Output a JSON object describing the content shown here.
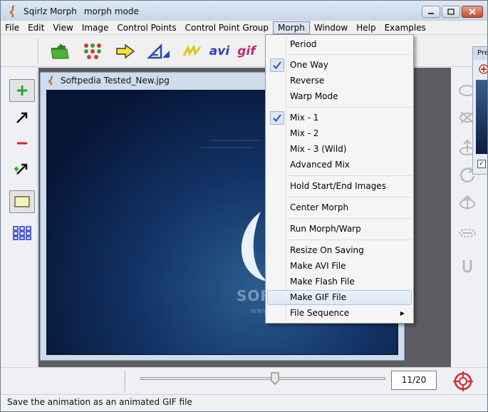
{
  "window": {
    "title": "Sqirlz Morph",
    "mode": "morph mode",
    "minimize_icon": "minimize-icon",
    "maximize_icon": "maximize-icon",
    "close_icon": "close-icon"
  },
  "menubar": {
    "items": [
      "File",
      "Edit",
      "View",
      "Image",
      "Control Points",
      "Control Point Group",
      "Morph",
      "Window",
      "Help",
      "Examples"
    ],
    "active": "Morph"
  },
  "toolbar": {
    "buttons": [
      {
        "icon": "open-folder-icon"
      },
      {
        "icon": "control-points-icon"
      },
      {
        "icon": "arrow-right-icon"
      },
      {
        "icon": "warp-triangle-icon"
      },
      {
        "icon": "flash-icon"
      },
      {
        "label": "avi",
        "icon": "avi-icon"
      },
      {
        "label": "gif",
        "icon": "gif-icon"
      }
    ],
    "avi_label": "avi",
    "gif_label": "gif"
  },
  "left_tools": [
    {
      "icon": "add-point-icon",
      "selected": true
    },
    {
      "icon": "move-point-icon",
      "selected": false
    },
    {
      "icon": "remove-point-icon",
      "selected": false
    },
    {
      "icon": "auto-point-icon",
      "selected": false
    },
    {
      "icon": "rectangle-select-icon",
      "selected": true
    },
    {
      "icon": "grid-icon",
      "selected": false
    }
  ],
  "document": {
    "title": "Softpedia Tested_New.jpg",
    "watermark": "SOFTPEDIA",
    "watermark_url": "www.softpedia.com"
  },
  "preview": {
    "title": "Pre"
  },
  "morph_menu": {
    "items": [
      {
        "label": "Period",
        "checked": false
      },
      {
        "separator": true
      },
      {
        "label": "One Way",
        "checked": true
      },
      {
        "label": "Reverse",
        "checked": false
      },
      {
        "label": "Warp Mode",
        "checked": false
      },
      {
        "separator": true
      },
      {
        "label": "Mix - 1",
        "checked": true
      },
      {
        "label": "Mix - 2",
        "checked": false
      },
      {
        "label": "Mix - 3 (Wild)",
        "checked": false
      },
      {
        "label": "Advanced Mix",
        "checked": false
      },
      {
        "separator": true
      },
      {
        "label": "Hold Start/End Images",
        "checked": false
      },
      {
        "separator": true
      },
      {
        "label": "Center Morph",
        "checked": false
      },
      {
        "separator": true
      },
      {
        "label": "Run Morph/Warp",
        "checked": false
      },
      {
        "separator": true
      },
      {
        "label": "Resize On Saving",
        "checked": false
      },
      {
        "label": "Make AVI File",
        "checked": false
      },
      {
        "label": "Make Flash File",
        "checked": false
      },
      {
        "label": "Make GIF File",
        "checked": false,
        "highlighted": true
      },
      {
        "label": "File Sequence",
        "checked": false,
        "submenu": true
      }
    ]
  },
  "playback": {
    "frame_counter": "11/20",
    "slider_position": 0.55,
    "current_frame": 11,
    "total_frames": 20
  },
  "status_bar": {
    "text": "Save the animation as an animated GIF file"
  },
  "colors": {
    "accent": "#3b6fd6",
    "highlight": "#dce9f8",
    "image_dark": "#071637"
  }
}
